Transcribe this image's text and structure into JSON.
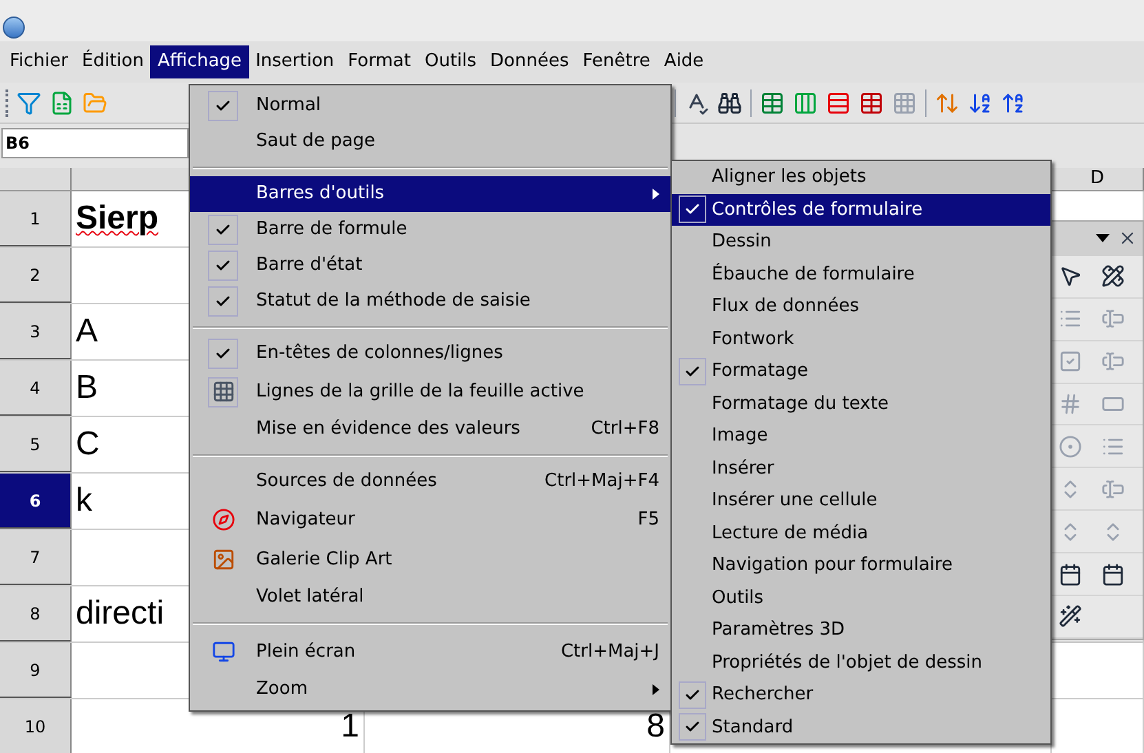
{
  "menu_bar": [
    {
      "label": "Fichier",
      "selected": false
    },
    {
      "label": "Édition",
      "selected": false
    },
    {
      "label": "Affichage",
      "selected": true
    },
    {
      "label": "Insertion",
      "selected": false
    },
    {
      "label": "Format",
      "selected": false
    },
    {
      "label": "Outils",
      "selected": false
    },
    {
      "label": "Données",
      "selected": false
    },
    {
      "label": "Fenêtre",
      "selected": false
    },
    {
      "label": "Aide",
      "selected": false
    }
  ],
  "name_box": {
    "value": "B6"
  },
  "column_headers": [
    "D"
  ],
  "rows": [
    {
      "number": "1",
      "selected": false,
      "cells": [
        {
          "text": "Sierp",
          "bold": true,
          "misspelled": true
        },
        null
      ]
    },
    {
      "number": "2",
      "selected": false,
      "cells": [
        null,
        null
      ]
    },
    {
      "number": "3",
      "selected": false,
      "cells": [
        {
          "text": "A",
          "bold": false,
          "misspelled": false
        },
        null
      ]
    },
    {
      "number": "4",
      "selected": false,
      "cells": [
        {
          "text": "B",
          "bold": false,
          "misspelled": false
        },
        null
      ]
    },
    {
      "number": "5",
      "selected": false,
      "cells": [
        {
          "text": "C",
          "bold": false,
          "misspelled": false
        },
        null
      ]
    },
    {
      "number": "6",
      "selected": true,
      "cells": [
        {
          "text": "k",
          "bold": false,
          "misspelled": false
        },
        null
      ]
    },
    {
      "number": "7",
      "selected": false,
      "cells": [
        null,
        null
      ]
    },
    {
      "number": "8",
      "selected": false,
      "cells": [
        {
          "text": "directi",
          "bold": false,
          "misspelled": false
        },
        null
      ]
    },
    {
      "number": "9",
      "selected": false,
      "cells": [
        null,
        null
      ]
    },
    {
      "number": "10",
      "selected": false,
      "cells": [
        {
          "text": "1",
          "bold": false,
          "misspelled": false
        },
        {
          "text": "8",
          "bold": false,
          "misspelled": false
        }
      ]
    }
  ],
  "view_menu": {
    "items": [
      {
        "kind": "item",
        "label": "Normal",
        "checked": true,
        "selected": false
      },
      {
        "kind": "item",
        "label": "Saut de page",
        "checked": false,
        "selected": false
      },
      {
        "kind": "separator"
      },
      {
        "kind": "submenu",
        "label": "Barres d'outils",
        "checked": false,
        "selected": true
      },
      {
        "kind": "item",
        "label": "Barre de formule",
        "checked": true,
        "selected": false
      },
      {
        "kind": "item",
        "label": "Barre d'état",
        "checked": true,
        "selected": false
      },
      {
        "kind": "item",
        "label": "Statut de la méthode de saisie",
        "checked": true,
        "selected": false
      },
      {
        "kind": "separator"
      },
      {
        "kind": "item",
        "label": "En-têtes de colonnes/lignes",
        "checked": true,
        "selected": false
      },
      {
        "kind": "icon",
        "label": "Lignes de la grille de la feuille active",
        "checked": true,
        "selected": false
      },
      {
        "kind": "item",
        "label": "Mise en évidence des valeurs",
        "shortcut": "Ctrl+F8",
        "checked": false,
        "selected": false
      },
      {
        "kind": "separator"
      },
      {
        "kind": "item",
        "label": "Sources de données",
        "shortcut": "Ctrl+Maj+F4",
        "checked": false,
        "selected": false
      },
      {
        "kind": "icon",
        "label": "Navigateur",
        "shortcut": "F5",
        "checked": false,
        "selected": false
      },
      {
        "kind": "icon",
        "label": "Galerie Clip Art",
        "checked": false,
        "selected": false
      },
      {
        "kind": "item",
        "label": "Volet latéral",
        "checked": false,
        "selected": false
      },
      {
        "kind": "separator"
      },
      {
        "kind": "icon",
        "label": "Plein écran",
        "shortcut": "Ctrl+Maj+J",
        "checked": false,
        "selected": false
      },
      {
        "kind": "submenu",
        "label": "Zoom",
        "checked": false,
        "selected": false
      }
    ]
  },
  "toolbars_submenu": {
    "items": [
      {
        "label": "Aligner les objets",
        "checked": false,
        "selected": false
      },
      {
        "label": "Contrôles de formulaire",
        "checked": true,
        "selected": true
      },
      {
        "label": "Dessin",
        "checked": false,
        "selected": false
      },
      {
        "label": "Ébauche de formulaire",
        "checked": false,
        "selected": false
      },
      {
        "label": "Flux de données",
        "checked": false,
        "selected": false
      },
      {
        "label": "Fontwork",
        "checked": false,
        "selected": false
      },
      {
        "label": "Formatage",
        "checked": true,
        "selected": false
      },
      {
        "label": "Formatage du texte",
        "checked": false,
        "selected": false
      },
      {
        "label": "Image",
        "checked": false,
        "selected": false
      },
      {
        "label": "Insérer",
        "checked": false,
        "selected": false
      },
      {
        "label": "Insérer une cellule",
        "checked": false,
        "selected": false
      },
      {
        "label": "Lecture de média",
        "checked": false,
        "selected": false
      },
      {
        "label": "Navigation pour formulaire",
        "checked": false,
        "selected": false
      },
      {
        "label": "Outils",
        "checked": false,
        "selected": false
      },
      {
        "label": "Paramètres 3D",
        "checked": false,
        "selected": false
      },
      {
        "label": "Propriétés de l'objet de dessin",
        "checked": false,
        "selected": false
      },
      {
        "label": "Rechercher",
        "checked": true,
        "selected": false
      },
      {
        "label": "Standard",
        "checked": true,
        "selected": false
      }
    ]
  }
}
